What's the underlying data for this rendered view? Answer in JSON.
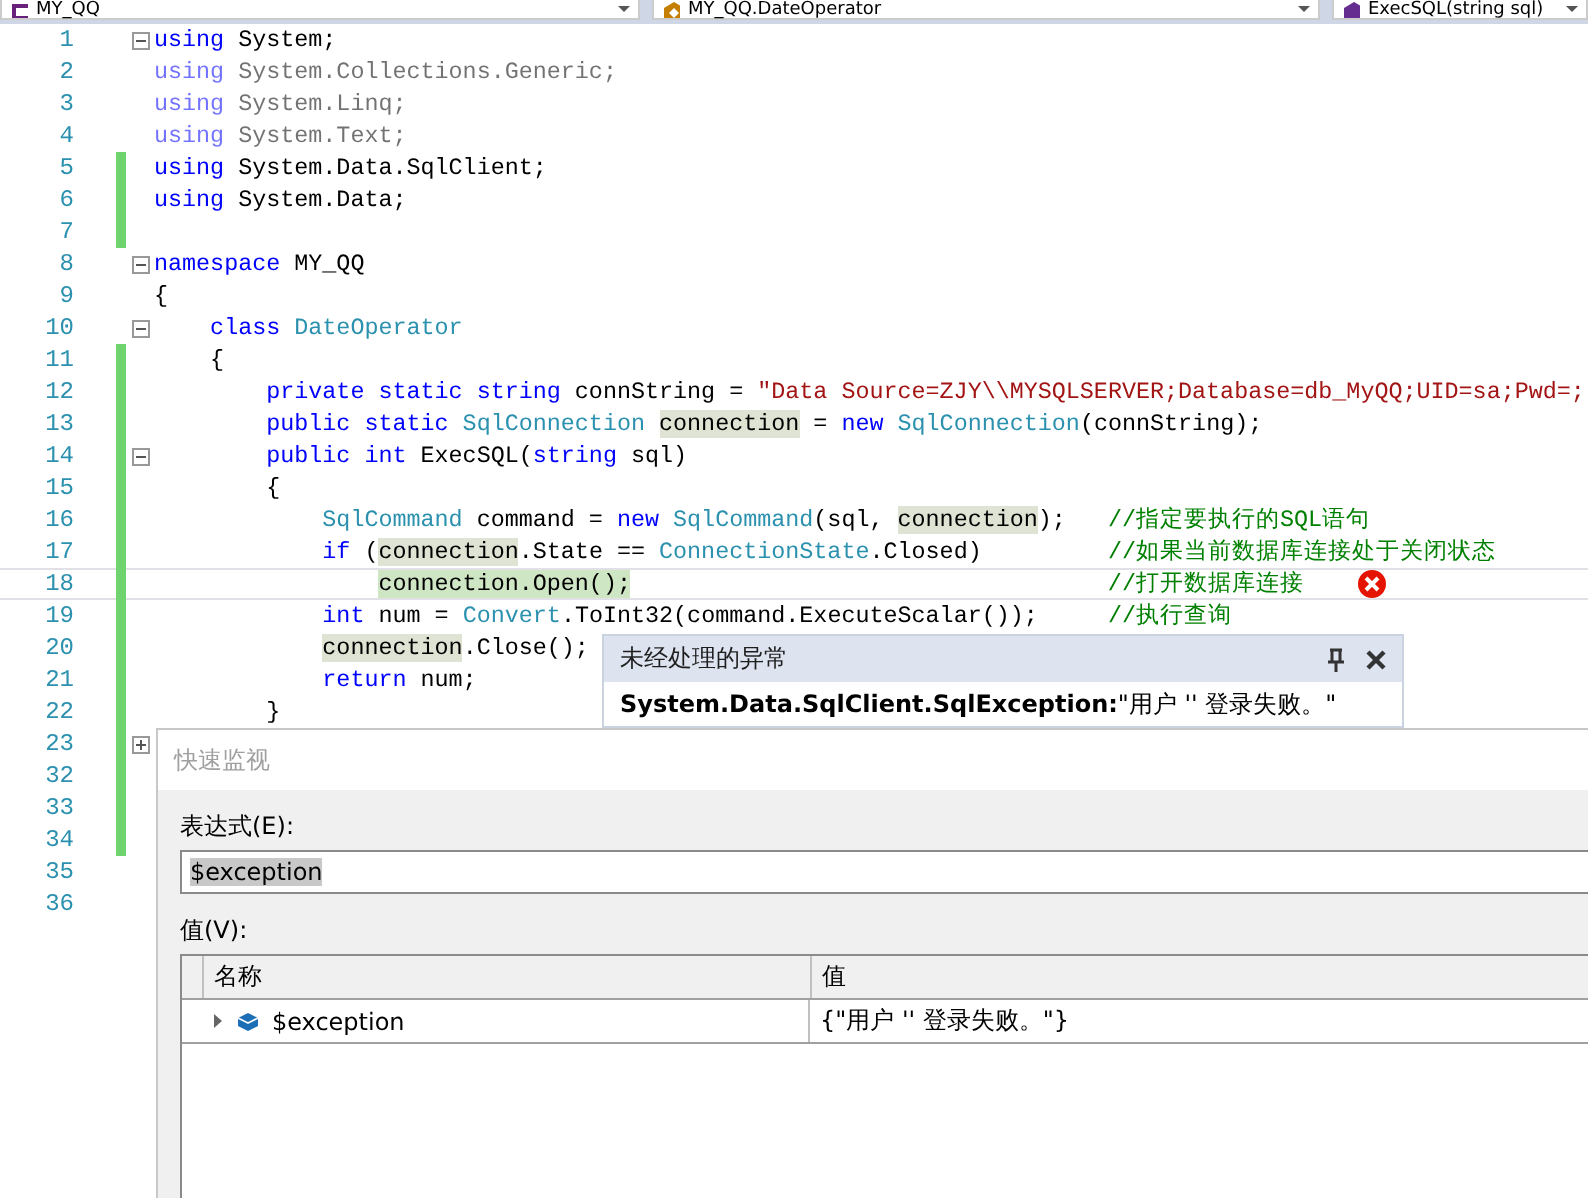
{
  "nav_bar": {
    "dropdowns": [
      {
        "label": "MY_QQ",
        "kind": "project"
      },
      {
        "label": "MY_QQ.DateOperator",
        "kind": "class"
      },
      {
        "label": "ExecSQL(string sql)",
        "kind": "method"
      }
    ]
  },
  "editor": {
    "lines": [
      {
        "number": "1",
        "collapsed": false,
        "changed": false,
        "faded": false,
        "current": false,
        "tokens": [
          {
            "kind": "keyword",
            "text": "using"
          },
          {
            "kind": "plain",
            "text": " System;"
          }
        ]
      },
      {
        "number": "2",
        "changed": false,
        "faded": true,
        "current": false,
        "tokens": [
          {
            "kind": "keyword",
            "text": "using"
          },
          {
            "kind": "plain",
            "text": " System.Collections.Generic;"
          }
        ]
      },
      {
        "number": "3",
        "changed": false,
        "faded": true,
        "current": false,
        "tokens": [
          {
            "kind": "keyword",
            "text": "using"
          },
          {
            "kind": "plain",
            "text": " System.Linq;"
          }
        ]
      },
      {
        "number": "4",
        "changed": false,
        "faded": true,
        "current": false,
        "tokens": [
          {
            "kind": "keyword",
            "text": "using"
          },
          {
            "kind": "plain",
            "text": " System.Text;"
          }
        ]
      },
      {
        "number": "5",
        "changed": true,
        "faded": false,
        "current": false,
        "tokens": [
          {
            "kind": "keyword",
            "text": "using"
          },
          {
            "kind": "plain",
            "text": " System.Data.SqlClient;"
          }
        ]
      },
      {
        "number": "6",
        "changed": true,
        "faded": false,
        "current": false,
        "tokens": [
          {
            "kind": "keyword",
            "text": "using"
          },
          {
            "kind": "plain",
            "text": " System.Data;"
          }
        ]
      },
      {
        "number": "7",
        "changed": true,
        "faded": false,
        "current": false
      },
      {
        "number": "8",
        "collapsed": false,
        "changed": false,
        "faded": false,
        "current": false,
        "tokens": [
          {
            "kind": "keyword",
            "text": "namespace"
          },
          {
            "kind": "plain",
            "text": " MY_QQ"
          }
        ]
      },
      {
        "number": "9",
        "changed": false,
        "faded": false,
        "current": false,
        "tokens": [
          {
            "kind": "plain",
            "text": "{"
          }
        ]
      },
      {
        "number": "10",
        "collapsed": false,
        "changed": false,
        "faded": false,
        "current": false,
        "tokens": [
          {
            "kind": "keyword",
            "text": "    class"
          },
          {
            "kind": "type",
            "text": " DateOperator"
          }
        ]
      },
      {
        "number": "11",
        "changed": true,
        "faded": false,
        "current": false,
        "tokens": [
          {
            "kind": "plain",
            "text": "    {"
          }
        ]
      },
      {
        "number": "12",
        "changed": true,
        "faded": false,
        "current": false,
        "tokens": [
          {
            "kind": "keyword",
            "text": "        private static string"
          },
          {
            "kind": "plain",
            "text": " connString = "
          },
          {
            "kind": "string",
            "text": "\"Data Source=ZJY\\\\MYSQLSERVER;Database=db_MyQQ;UID=sa;Pwd=;"
          }
        ]
      },
      {
        "number": "13",
        "changed": true,
        "faded": false,
        "current": false,
        "tokens": [
          {
            "kind": "keyword",
            "text": "        public static"
          },
          {
            "kind": "type",
            "text": " SqlConnection "
          },
          {
            "kind": "reference",
            "text": "connection"
          },
          {
            "kind": "plain",
            "text": " = "
          },
          {
            "kind": "keyword",
            "text": "new"
          },
          {
            "kind": "type",
            "text": " SqlConnection"
          },
          {
            "kind": "plain",
            "text": "(connString);"
          }
        ]
      },
      {
        "number": "14",
        "collapsed": false,
        "changed": true,
        "faded": false,
        "current": false,
        "tokens": [
          {
            "kind": "keyword",
            "text": "        public int"
          },
          {
            "kind": "plain",
            "text": " ExecSQL("
          },
          {
            "kind": "keyword",
            "text": "string"
          },
          {
            "kind": "plain",
            "text": " sql)"
          }
        ]
      },
      {
        "number": "15",
        "changed": true,
        "faded": false,
        "current": false,
        "tokens": [
          {
            "kind": "plain",
            "text": "        {"
          }
        ]
      },
      {
        "number": "16",
        "changed": true,
        "faded": false,
        "current": false,
        "tokens": [
          {
            "kind": "type",
            "text": "            SqlCommand"
          },
          {
            "kind": "plain",
            "text": " command = "
          },
          {
            "kind": "keyword",
            "text": "new"
          },
          {
            "kind": "type",
            "text": " SqlCommand"
          },
          {
            "kind": "plain",
            "text": "(sql, "
          },
          {
            "kind": "reference",
            "text": "connection"
          },
          {
            "kind": "plain",
            "text": ");"
          },
          {
            "kind": "comment",
            "text": "   //指定要执行的SQL语句"
          }
        ]
      },
      {
        "number": "17",
        "changed": true,
        "faded": false,
        "current": false,
        "tokens": [
          {
            "kind": "keyword",
            "text": "            if"
          },
          {
            "kind": "plain",
            "text": " ("
          },
          {
            "kind": "reference",
            "text": "connection"
          },
          {
            "kind": "plain",
            "text": ".State == "
          },
          {
            "kind": "type",
            "text": "ConnectionState"
          },
          {
            "kind": "plain",
            "text": ".Closed)"
          },
          {
            "kind": "comment",
            "text": "         //如果当前数据库连接处于关闭状态"
          }
        ]
      },
      {
        "number": "18",
        "changed": true,
        "faded": false,
        "current": true,
        "tokens": [
          {
            "kind": "reference",
            "text": "                connection"
          },
          {
            "kind": "executing",
            "text": ".Open();"
          },
          {
            "kind": "comment",
            "text": "                                  //打开数据库连接"
          }
        ]
      },
      {
        "number": "19",
        "changed": true,
        "faded": false,
        "current": false,
        "tokens": [
          {
            "kind": "keyword",
            "text": "            int"
          },
          {
            "kind": "plain",
            "text": " num = "
          },
          {
            "kind": "type",
            "text": "Convert"
          },
          {
            "kind": "plain",
            "text": ".ToInt32(command.ExecuteScalar());"
          },
          {
            "kind": "comment",
            "text": "     //执行查询"
          }
        ]
      },
      {
        "number": "20",
        "changed": true,
        "faded": false,
        "current": false,
        "tokens": [
          {
            "kind": "reference",
            "text": "            connection"
          },
          {
            "kind": "plain",
            "text": ".Close();"
          }
        ]
      },
      {
        "number": "21",
        "changed": true,
        "faded": false,
        "current": false,
        "tokens": [
          {
            "kind": "keyword",
            "text": "            return"
          },
          {
            "kind": "plain",
            "text": " num;"
          }
        ]
      },
      {
        "number": "22",
        "changed": true,
        "faded": false,
        "current": false,
        "tokens": [
          {
            "kind": "plain",
            "text": "        }"
          }
        ]
      },
      {
        "number": "23",
        "collapsed": true,
        "changed": true,
        "faded": false,
        "current": false
      },
      {
        "number": "32",
        "changed": true,
        "faded": false,
        "current": false
      },
      {
        "number": "33",
        "changed": true,
        "faded": false,
        "current": false
      },
      {
        "number": "34",
        "changed": true,
        "faded": false,
        "current": false
      },
      {
        "number": "35",
        "changed": false,
        "faded": false,
        "current": false
      },
      {
        "number": "36",
        "changed": false,
        "faded": false,
        "current": false
      }
    ]
  },
  "exception_popup": {
    "title": "未经处理的异常",
    "message": "**System.Data.SqlClient.SqlException:**\"用户 '' 登录失败。\""
  },
  "quick_watch": {
    "title": "快速监视",
    "expression_label": "表达式(E):",
    "expression": "$exception",
    "expression_selected": true,
    "value_label": "值(V):",
    "columns": [
      "名称",
      "值"
    ],
    "rows": [
      {
        "name": "$exception",
        "value": "{\"用户 '' 登录失败。\"}",
        "expanded": false
      }
    ]
  }
}
